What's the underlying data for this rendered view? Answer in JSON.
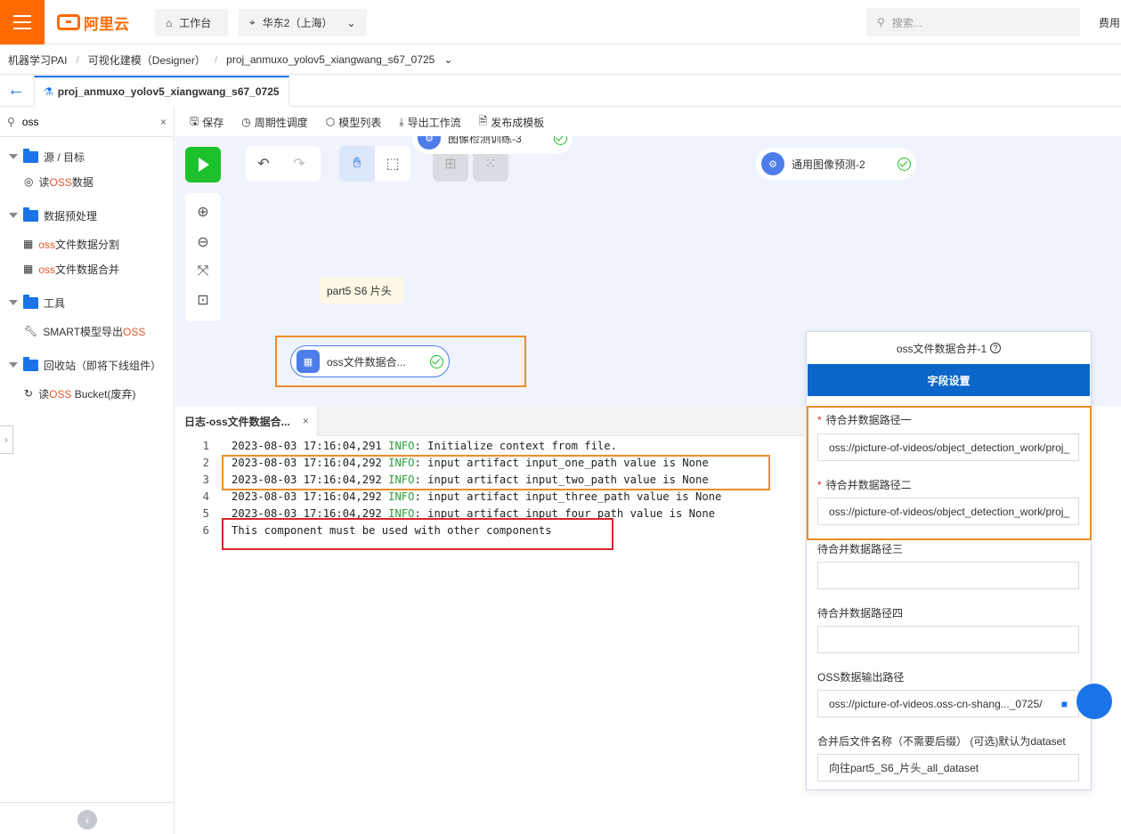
{
  "topbar": {
    "brand": "阿里云",
    "workbench": "工作台",
    "region": "华东2（上海）",
    "search_placeholder": "搜索...",
    "fee": "费用"
  },
  "breadcrumb": [
    "机器学习PAI",
    "可视化建模（Designer）",
    "proj_anmuxo_yolov5_xiangwang_s67_0725"
  ],
  "project_tab": "proj_anmuxo_yolov5_xiangwang_s67_0725",
  "sidebar": {
    "search_value": "oss",
    "groups": [
      {
        "label": "源 / 目标",
        "items": [
          {
            "pre": "读",
            "hl": "OSS",
            "post": "数据"
          }
        ]
      },
      {
        "label": "数据预处理",
        "items": [
          {
            "pre": "",
            "hl": "oss",
            "post": "文件数据分割"
          },
          {
            "pre": "",
            "hl": "oss",
            "post": "文件数据合并"
          }
        ]
      },
      {
        "label": "工具",
        "items": [
          {
            "pre": "SMART模型导出",
            "hl": "OSS",
            "post": ""
          }
        ]
      },
      {
        "label": "回收站（即将下线组件）",
        "items": [
          {
            "pre": "读",
            "hl": "OSS",
            "post": " Bucket(废弃)"
          }
        ]
      }
    ]
  },
  "toolbar": {
    "save": "保存",
    "schedule": "周期性调度",
    "models": "模型列表",
    "export": "导出工作流",
    "publish": "发布成模板"
  },
  "canvas": {
    "node_top_partial": "图像检测训练-3",
    "node_predict": "通用图像预测-2",
    "note": "part5 S6 片头",
    "node_merge": "oss文件数据合..."
  },
  "log": {
    "tab_title": "日志-oss文件数据合...",
    "lines": [
      {
        "n": "1",
        "ts": "2023-08-03 17:16:04,291",
        "lvl": "INFO",
        "msg": ": Initialize context from file."
      },
      {
        "n": "2",
        "ts": "2023-08-03 17:16:04,292",
        "lvl": "INFO",
        "msg": ": input artifact input_one_path value is None"
      },
      {
        "n": "3",
        "ts": "2023-08-03 17:16:04,292",
        "lvl": "INFO",
        "msg": ": input artifact input_two_path value is None"
      },
      {
        "n": "4",
        "ts": "2023-08-03 17:16:04,292",
        "lvl": "INFO",
        "msg": ": input artifact input_three_path value is None"
      },
      {
        "n": "5",
        "ts": "2023-08-03 17:16:04,292",
        "lvl": "INFO",
        "msg": ": input artifact input_four_path value is None"
      },
      {
        "n": "6",
        "ts": "",
        "lvl": "",
        "msg": "This component must be used with other components"
      }
    ]
  },
  "props": {
    "title": "oss文件数据合并-1",
    "tab": "字段设置",
    "fields": [
      {
        "label": "待合并数据路径一",
        "required": "*",
        "value": "oss://picture-of-videos/object_detection_work/proj_"
      },
      {
        "label": "待合并数据路径二",
        "required": "*",
        "value": "oss://picture-of-videos/object_detection_work/proj_"
      },
      {
        "label": "待合并数据路径三",
        "required": "",
        "value": ""
      },
      {
        "label": "待合并数据路径四",
        "required": "",
        "value": ""
      },
      {
        "label": "OSS数据输出路径",
        "required": "",
        "value": "oss://picture-of-videos.oss-cn-shang..._0725/"
      },
      {
        "label": "合并后文件名称（不需要后缀） (可选)默认为dataset",
        "required": "",
        "value": "向往part5_S6_片头_all_dataset"
      }
    ]
  },
  "colors": {
    "brand": "#ff6a00",
    "primary": "#1a73e8",
    "run": "#1cc12b",
    "highlight_box": "#f08c2b",
    "error_box": "#d9242e"
  }
}
